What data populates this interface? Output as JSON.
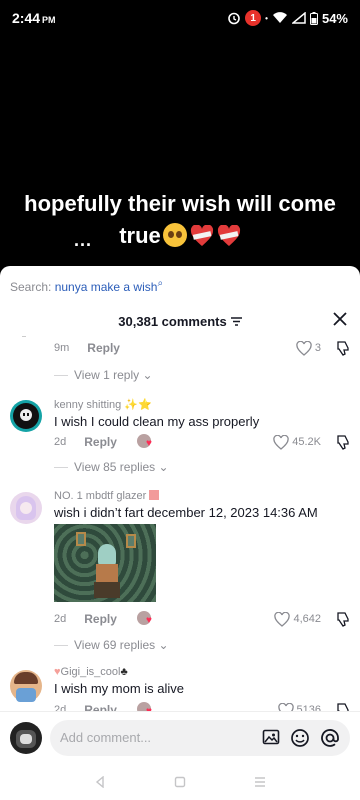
{
  "status_bar": {
    "time": "2:44",
    "ampm": "PM",
    "notification_count": "1",
    "battery": "54%"
  },
  "video": {
    "caption_line1": "hopefully their wish will come",
    "caption_line2": "true",
    "caption_prefix": "..."
  },
  "search": {
    "label": "Search:",
    "query": "nunya make a wish"
  },
  "header": {
    "comment_count": "30,381 comments"
  },
  "comments": [
    {
      "time": "9m",
      "reply_label": "Reply",
      "likes": "3",
      "view_replies": "View 1 reply"
    },
    {
      "user": "kenny shitting",
      "text": "I wish I could clean my ass properly",
      "time": "2d",
      "reply_label": "Reply",
      "likes": "45.2K",
      "view_replies": "View 85 replies"
    },
    {
      "user": "NO. 1 mbdtf glazer",
      "text": "wish i didn’t fart december 12, 2023 14:36 AM",
      "time": "2d",
      "reply_label": "Reply",
      "likes": "4,642",
      "view_replies": "View 69 replies"
    },
    {
      "user": "Gigi_is_cool",
      "text": "I wish my mom is alive",
      "time": "2d",
      "reply_label": "Reply",
      "likes": "5136"
    }
  ],
  "composer": {
    "placeholder": "Add comment..."
  },
  "icons": {
    "close": "close-icon",
    "filter": "filter-icon",
    "heart": "heart-icon",
    "dislike": "dislike-icon",
    "image": "image-icon",
    "emoji": "emoji-icon",
    "mention": "at-icon",
    "back": "back-icon",
    "home": "home-icon",
    "recents": "recents-icon"
  },
  "colors": {
    "accent_link": "#2b5db9",
    "muted": "#8a8b91",
    "badge": "#e8322b"
  }
}
